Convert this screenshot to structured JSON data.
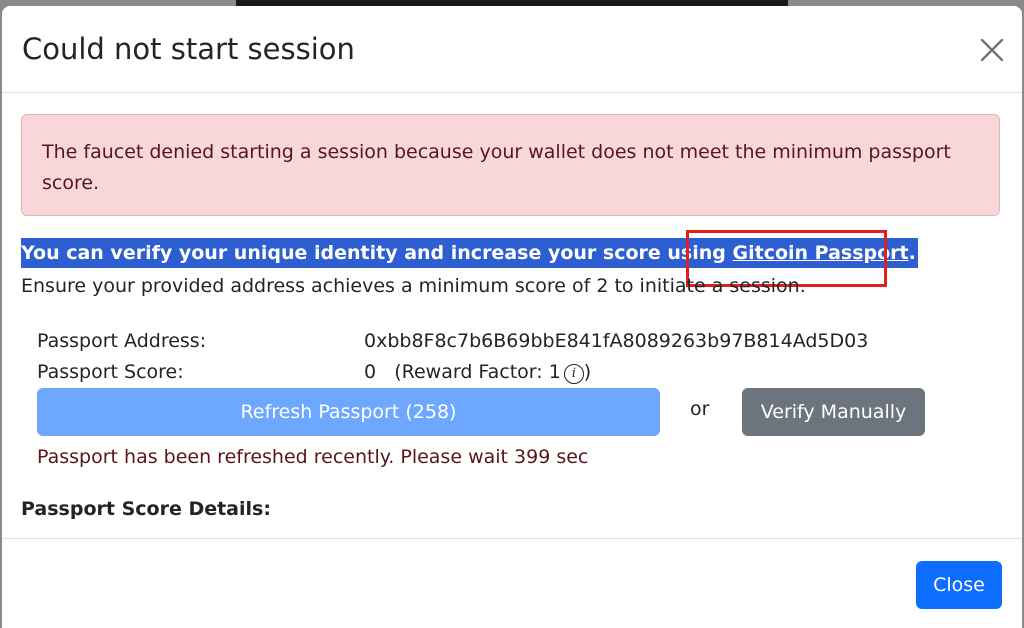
{
  "modal": {
    "title": "Could not start session",
    "close_icon": "close-icon"
  },
  "alert": {
    "message": "The faucet denied starting a session because your wallet does not meet the minimum passport score."
  },
  "info": {
    "text": "You can verify your unique identity and increase your score using ",
    "link_label": "Gitcoin Passport",
    "suffix": ".",
    "requirement": "Ensure your provided address achieves a minimum score of 2 to initiate a session."
  },
  "passport": {
    "address_label": "Passport Address:",
    "address_value": "0xbb8F8c7b6B69bbE841fA8089263b97B814Ad5D03",
    "score_label": "Passport Score:",
    "score_value": "0",
    "reward_text": "(Reward Factor: 1",
    "reward_close": ")",
    "info_icon": "info-icon"
  },
  "actions": {
    "refresh_label": "Refresh Passport (258)",
    "or_text": "or",
    "verify_label": "Verify Manually",
    "refresh_message": "Passport has been refreshed recently. Please wait 399 sec"
  },
  "details": {
    "heading": "Passport Score Details:"
  },
  "footer": {
    "close_label": "Close"
  },
  "colors": {
    "primary": "#0d6efd",
    "primary_light": "#6ea8fe",
    "secondary": "#6c757d",
    "danger_bg": "#f8d7da",
    "danger_text": "#58151c",
    "selection": "#2d5fd1",
    "annotation_box": "#e02020"
  }
}
